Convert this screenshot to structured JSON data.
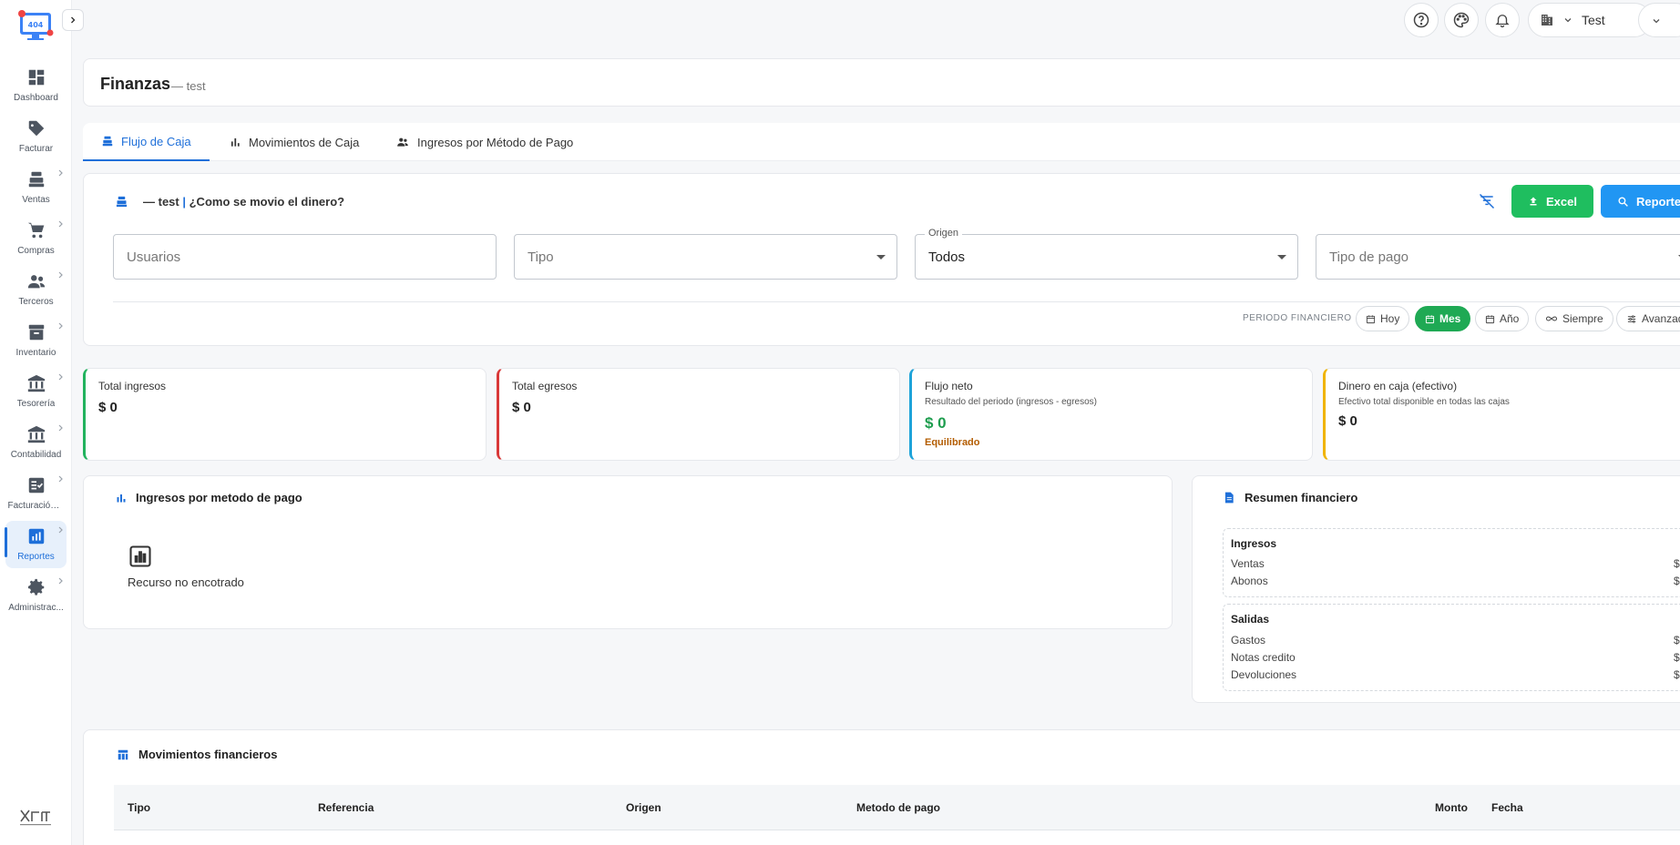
{
  "sidebar": {
    "items": [
      {
        "label": "Dashboard",
        "icon": "dashboard-icon"
      },
      {
        "label": "Facturar",
        "icon": "tag-icon"
      },
      {
        "label": "Ventas",
        "icon": "cash-register-icon"
      },
      {
        "label": "Compras",
        "icon": "cart-icon"
      },
      {
        "label": "Terceros",
        "icon": "people-icon"
      },
      {
        "label": "Inventario",
        "icon": "archive-icon"
      },
      {
        "label": "Tesorería",
        "icon": "bank-icon"
      },
      {
        "label": "Contabilidad",
        "icon": "institution-icon"
      },
      {
        "label": "Facturación ...",
        "icon": "invoice-check-icon"
      },
      {
        "label": "Reportes",
        "icon": "report-chart-icon"
      },
      {
        "label": "Administrac...",
        "icon": "gear-icon"
      }
    ]
  },
  "topbar": {
    "company_name": "Test"
  },
  "page": {
    "title": "Finanzas",
    "subtitle": "— test"
  },
  "tabs": [
    {
      "label": "Flujo de Caja"
    },
    {
      "label": "Movimientos de Caja"
    },
    {
      "label": "Ingresos por Método de Pago"
    }
  ],
  "filters": {
    "title_prefix": "— test",
    "title_sep": " | ",
    "title_question": "¿Como se movio el dinero?",
    "excel_label": "Excel",
    "report_label": "Reporte",
    "usuarios_placeholder": "Usuarios",
    "tipo_placeholder": "Tipo",
    "origen_label": "Origen",
    "origen_value": "Todos",
    "tipo_pago_placeholder": "Tipo de pago",
    "period_label": "PERIODO FINANCIERO",
    "periods": [
      {
        "label": "Hoy"
      },
      {
        "label": "Mes"
      },
      {
        "label": "Año"
      },
      {
        "label": "Siempre"
      },
      {
        "label": "Avanzado"
      }
    ]
  },
  "kpis": {
    "ingresos": {
      "title": "Total ingresos",
      "value": "$ 0",
      "color": "#22b35e"
    },
    "egresos": {
      "title": "Total egresos",
      "value": "$ 0",
      "color": "#d93838"
    },
    "flujo": {
      "title": "Flujo neto",
      "desc": "Resultado del periodo (ingresos - egresos)",
      "value": "$ 0",
      "status": "Equilibrado",
      "color": "#1ea3d9"
    },
    "caja": {
      "title": "Dinero en caja (efectivo)",
      "desc": "Efectivo total disponible en todas las cajas",
      "value": "$ 0",
      "color": "#f0b400"
    }
  },
  "chart_section": {
    "title": "Ingresos por metodo de pago",
    "empty_text": "Recurso no encotrado"
  },
  "resumen": {
    "title": "Resumen financiero",
    "ingresos": {
      "heading": "Ingresos",
      "rows": [
        {
          "label": "Ventas",
          "amount": "$"
        },
        {
          "label": "Abonos",
          "amount": "$"
        }
      ]
    },
    "salidas": {
      "heading": "Salidas",
      "rows": [
        {
          "label": "Gastos",
          "amount": "$"
        },
        {
          "label": "Notas credito",
          "amount": "$"
        },
        {
          "label": "Devoluciones",
          "amount": "$"
        }
      ]
    }
  },
  "movimientos": {
    "title": "Movimientos financieros",
    "columns": [
      "Tipo",
      "Referencia",
      "Origen",
      "Metodo de pago",
      "Monto",
      "Fecha"
    ]
  },
  "colors": {
    "primary": "#1e6fd9",
    "green": "#1fbe5f",
    "blue_button": "#2196f3"
  }
}
